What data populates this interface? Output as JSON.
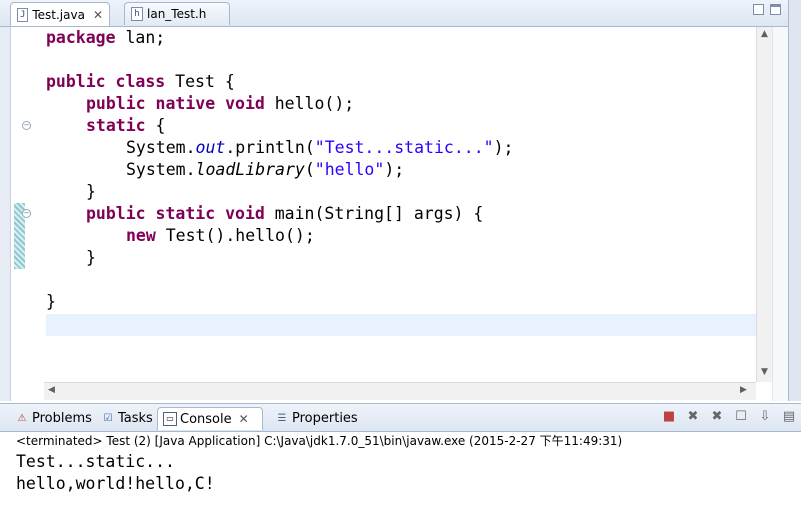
{
  "editor": {
    "tabs": [
      {
        "label": "Test.java",
        "icon": "java-file-icon",
        "active": true
      },
      {
        "label": "lan_Test.h",
        "icon": "header-file-icon",
        "active": false
      }
    ],
    "code": {
      "l1_kw": "package",
      "l1_rest": " lan;",
      "l3_kw": "public class",
      "l3_rest": " Test {",
      "l4_kw": "public native void",
      "l4_rest": " hello();",
      "l5_kw": "static",
      "l5_rest": " {",
      "l6_a": "System.",
      "l6_field": "out",
      "l6_b": ".println(",
      "l6_str": "\"Test...static...\"",
      "l6_c": ");",
      "l7_a": "System.",
      "l7_method": "loadLibrary",
      "l7_b": "(",
      "l7_str": "\"hello\"",
      "l7_c": ");",
      "l8": "}",
      "l9_kw": "public static void",
      "l9_rest": " main(String[] args) {",
      "l10_kw": "new",
      "l10_rest": " Test().hello();",
      "l11": "}",
      "l13": "}"
    }
  },
  "views": {
    "tabs": [
      {
        "label": "Problems",
        "icon": "problems-icon"
      },
      {
        "label": "Tasks",
        "icon": "tasks-icon"
      },
      {
        "label": "Console",
        "icon": "console-icon",
        "active": true
      },
      {
        "label": "Properties",
        "icon": "properties-icon"
      }
    ],
    "console": {
      "status": "<terminated> Test (2) [Java Application] C:\\Java\\jdk1.7.0_51\\bin\\javaw.exe (2015-2-27 下午11:49:31)",
      "output": [
        "Test...static...",
        "hello,world!hello,C!"
      ]
    }
  },
  "colors": {
    "keyword": "#7f0055",
    "string": "#2a00ff",
    "field": "#0000c0",
    "current_line": "#e8f2fe"
  }
}
